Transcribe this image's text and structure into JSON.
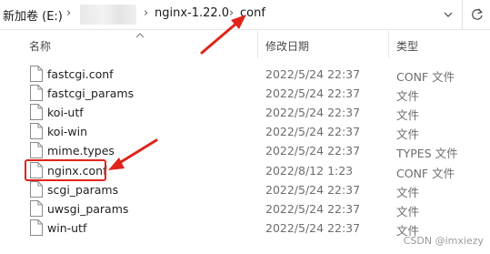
{
  "address_bar": {
    "drive": "新加卷 (E:)",
    "folder1": "nginx-1.22.0",
    "folder2": "conf"
  },
  "columns": {
    "name": "名称",
    "date": "修改日期",
    "type": "类型"
  },
  "files": [
    {
      "name": "fastcgi.conf",
      "date": "2022/5/24 22:37",
      "type": "CONF 文件"
    },
    {
      "name": "fastcgi_params",
      "date": "2022/5/24 22:37",
      "type": "文件"
    },
    {
      "name": "koi-utf",
      "date": "2022/5/24 22:37",
      "type": "文件"
    },
    {
      "name": "koi-win",
      "date": "2022/5/24 22:37",
      "type": "文件"
    },
    {
      "name": "mime.types",
      "date": "2022/5/24 22:37",
      "type": "TYPES 文件"
    },
    {
      "name": "nginx.conf",
      "date": "2022/8/12 1:23",
      "type": "CONF 文件"
    },
    {
      "name": "scgi_params",
      "date": "2022/5/24 22:37",
      "type": "文件"
    },
    {
      "name": "uwsgi_params",
      "date": "2022/5/24 22:37",
      "type": "文件"
    },
    {
      "name": "win-utf",
      "date": "2022/5/24 22:37",
      "type": "文件"
    }
  ],
  "watermark": "CSDN @imxiezy",
  "colors": {
    "annotation": "#e0241b"
  }
}
